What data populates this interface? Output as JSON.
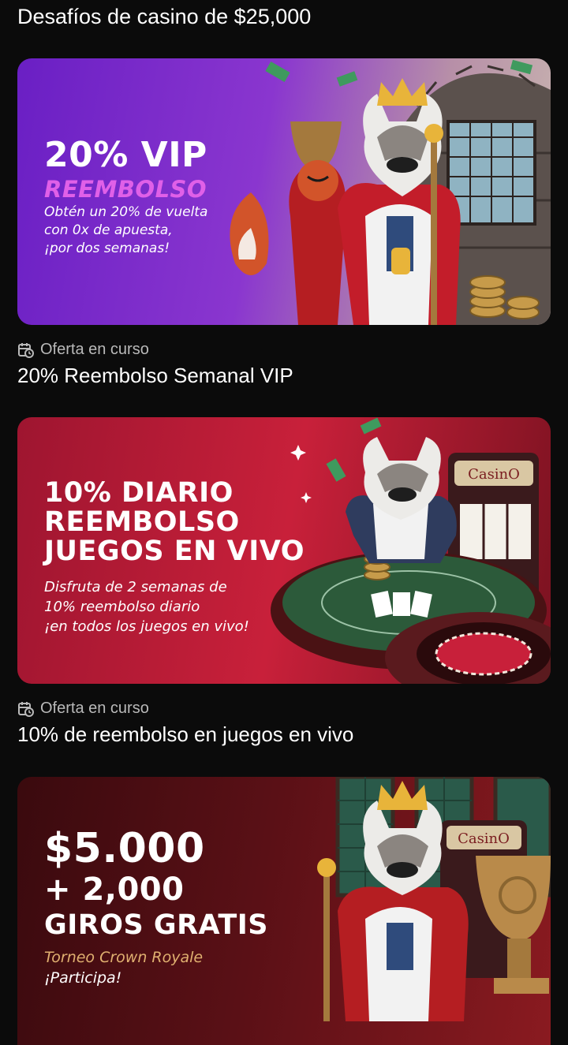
{
  "section": {
    "title": "Desafíos de casino de $25,000"
  },
  "offers": [
    {
      "banner": {
        "headline1": "20% VIP",
        "headline2": "REEMBOLSO",
        "desc1": "Obtén un 20% de vuelta",
        "desc2": "con 0x de apuesta,",
        "desc3": "¡por dos semanas!"
      },
      "status": "Oferta en curso",
      "title": "20% Reembolso Semanal VIP"
    },
    {
      "banner": {
        "headline1": "10% DIARIO",
        "headline2": "REEMBOLSO",
        "headline3": "JUEGOS EN VIVO",
        "desc1": "Disfruta de 2 semanas de",
        "desc2": "10% reembolso diario",
        "desc3": "¡en todos los juegos en vivo!",
        "sign": "CasinO"
      },
      "status": "Oferta en curso",
      "title": "10% de reembolso en juegos en vivo"
    },
    {
      "banner": {
        "headline1": "$5.000",
        "headline2": "+ 2,000",
        "headline3": "GIROS GRATIS",
        "desc1": "Torneo Crown Royale",
        "desc2": "¡Participa!",
        "sign": "CasinO"
      }
    }
  ],
  "colors": {
    "background": "#0b0b0b",
    "vip_purple": "#7a2fd0",
    "vip_pink": "#e060e8",
    "live_red": "#c8203a",
    "crown_dark_red": "#4a0c10",
    "crown_gold": "#e0b070"
  }
}
